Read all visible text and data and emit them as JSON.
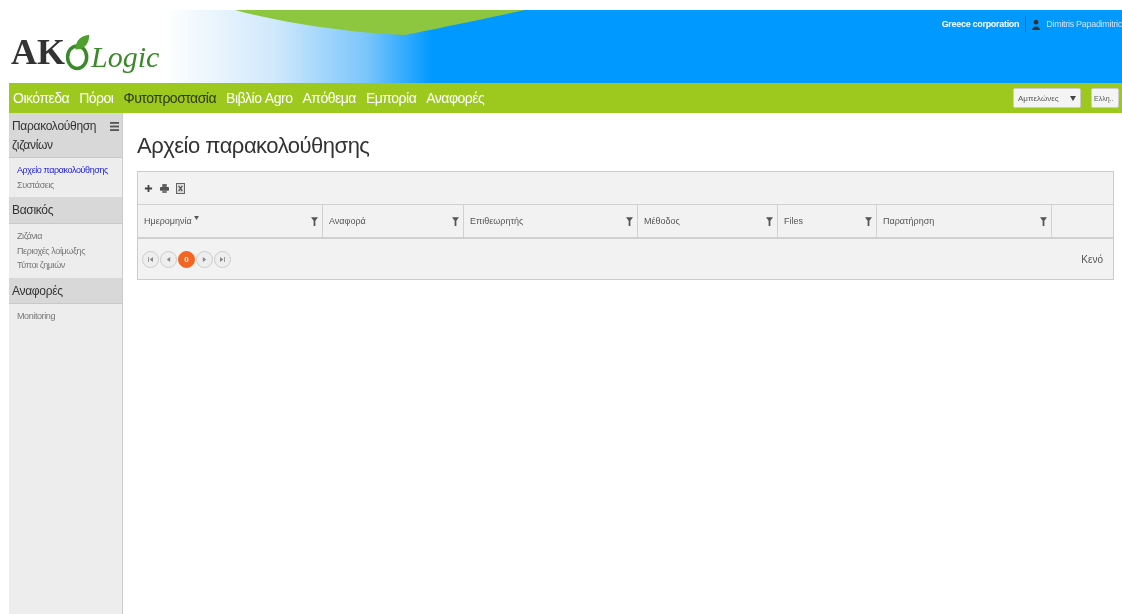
{
  "header": {
    "logo": {
      "left": "AK",
      "right": "Logic"
    },
    "company": "Greece corporation",
    "user": "Dimitris Papadimitric"
  },
  "nav": {
    "items": [
      {
        "label": "Οικόπεδα",
        "selected": false
      },
      {
        "label": "Πόροι",
        "selected": false
      },
      {
        "label": "Φυτοπροστασία",
        "selected": true
      },
      {
        "label": "Βιβλίο Agro",
        "selected": false
      },
      {
        "label": "Απόθεμα",
        "selected": false
      },
      {
        "label": "Εμπορία",
        "selected": false
      },
      {
        "label": "Αναφορές",
        "selected": false
      }
    ],
    "crop_select": "Αμπελώνες",
    "language_select": "Ελλη.."
  },
  "sidebar": {
    "sections": [
      {
        "title": "Παρακολούθηση ζιζανίων",
        "menu_icon": true,
        "items": [
          {
            "label": "Αρχείο παρακολούθησης",
            "selected": true
          },
          {
            "label": "Συστάσεις",
            "selected": false
          }
        ]
      },
      {
        "title": "Βασικός",
        "menu_icon": false,
        "items": [
          {
            "label": "Ζιζάνια",
            "selected": false
          },
          {
            "label": "Περιοχές λοίμωξης",
            "selected": false
          },
          {
            "label": "Τύποι ζημιών",
            "selected": false
          }
        ]
      },
      {
        "title": "Αναφορές",
        "menu_icon": false,
        "items": [
          {
            "label": "Monitoring",
            "selected": false
          }
        ]
      }
    ]
  },
  "page_title": "Αρχείο παρακολούθησης",
  "table": {
    "columns": [
      {
        "label": "Ημερομηνία",
        "sorted": true
      },
      {
        "label": "Αναφορά",
        "sorted": false
      },
      {
        "label": "Επιθεωρητής",
        "sorted": false
      },
      {
        "label": "Μέθοδος",
        "sorted": false
      },
      {
        "label": "Files",
        "sorted": false
      },
      {
        "label": "Παρατήρηση",
        "sorted": false
      }
    ],
    "pager": {
      "page": "0"
    },
    "status": "Κενό"
  }
}
